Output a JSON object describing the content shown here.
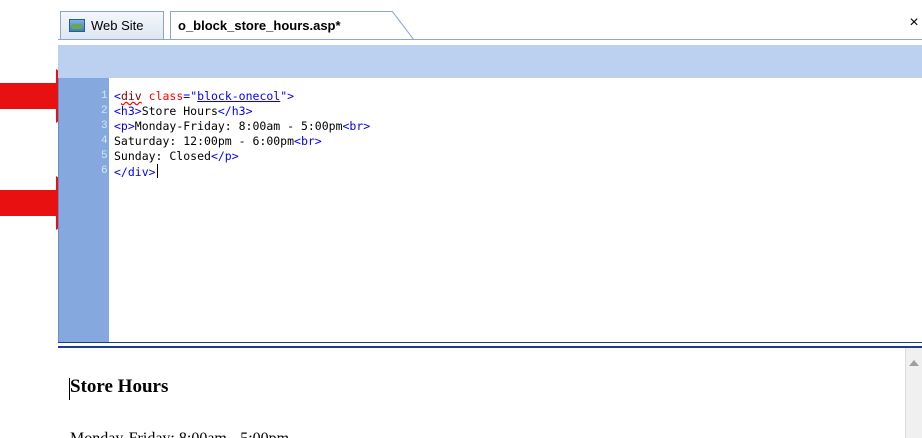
{
  "tabs": [
    {
      "label": "Web Site",
      "icon": "website-icon"
    },
    {
      "label": "o_block_store_hours.asp*"
    }
  ],
  "close_glyph": "×",
  "code": {
    "line_numbers": [
      "1",
      "2",
      "3",
      "4",
      "5",
      "6"
    ],
    "lines": [
      [
        {
          "t": "<",
          "c": "tg"
        },
        {
          "t": "div",
          "c": "tn sq"
        },
        {
          "t": " ",
          "c": ""
        },
        {
          "t": "class",
          "c": "an"
        },
        {
          "t": "=\"",
          "c": "tg"
        },
        {
          "t": "block-onecol",
          "c": "av"
        },
        {
          "t": "\">",
          "c": "tg"
        }
      ],
      [
        {
          "t": "<h3>",
          "c": "tg"
        },
        {
          "t": "Store Hours",
          "c": ""
        },
        {
          "t": "</h3>",
          "c": "tg"
        }
      ],
      [
        {
          "t": "<p>",
          "c": "tg"
        },
        {
          "t": "Monday-Friday: 8:00am - 5:00pm",
          "c": ""
        },
        {
          "t": "<br>",
          "c": "tg"
        }
      ],
      [
        {
          "t": "Saturday: 12:00pm - 6:00pm",
          "c": ""
        },
        {
          "t": "<br>",
          "c": "tg"
        }
      ],
      [
        {
          "t": "Sunday: Closed",
          "c": ""
        },
        {
          "t": "</p>",
          "c": "tg"
        }
      ],
      [
        {
          "t": "</div>",
          "c": "tg"
        }
      ]
    ]
  },
  "preview": {
    "heading": "Store Hours",
    "line1": "Monday-Friday: 8:00am - 5:00pm"
  },
  "colors": {
    "arrow": "#e81010",
    "gutter": "#85a9df",
    "strip": "#bcd1ef",
    "splitter": "#1a3e8c"
  }
}
